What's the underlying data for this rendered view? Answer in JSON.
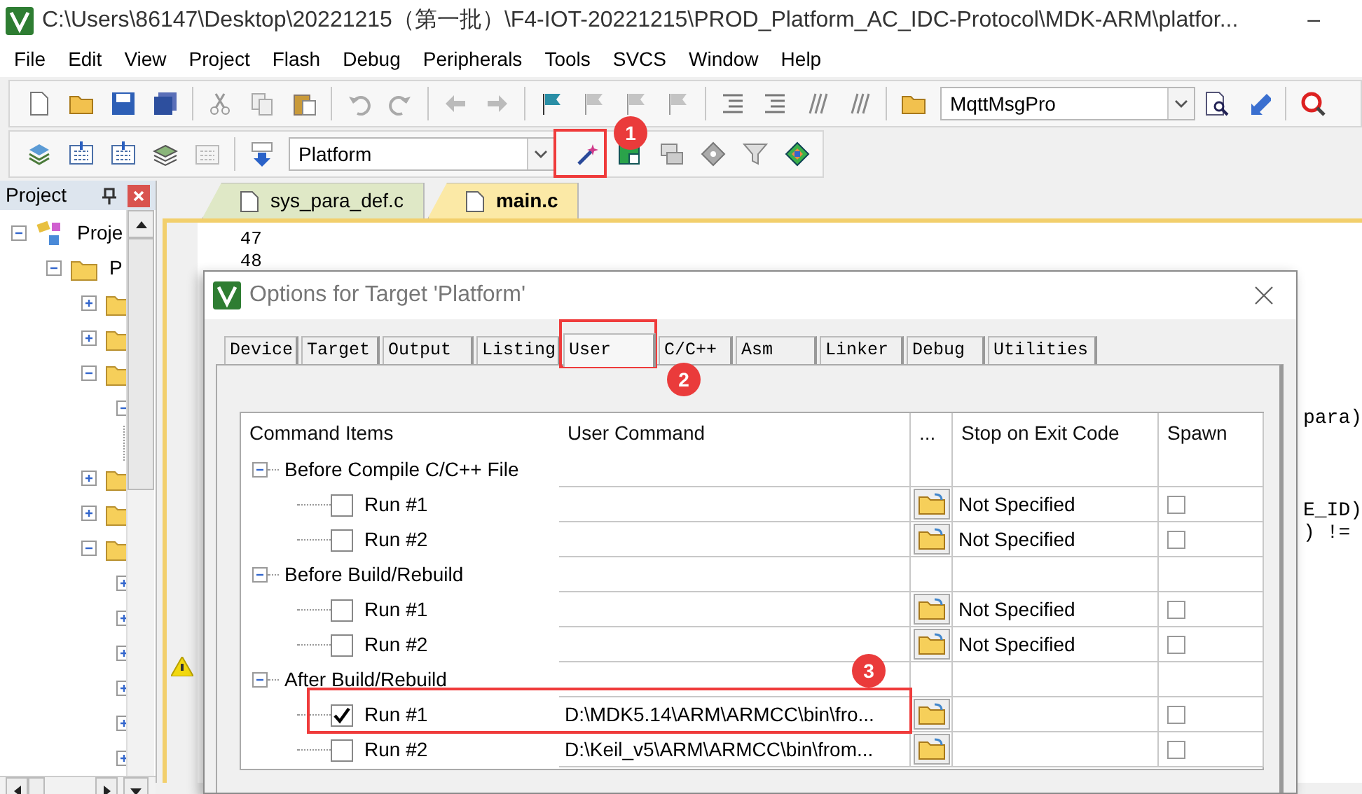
{
  "window": {
    "title": "C:\\Users\\86147\\Desktop\\20221215（第一批）\\F4-IOT-20221215\\PROD_Platform_AC_IDC-Protocol\\MDK-ARM\\platfor...",
    "minimize": "–"
  },
  "menu": [
    {
      "label": "File"
    },
    {
      "label": "Edit"
    },
    {
      "label": "View"
    },
    {
      "label": "Project"
    },
    {
      "label": "Flash"
    },
    {
      "label": "Debug"
    },
    {
      "label": "Peripherals"
    },
    {
      "label": "Tools"
    },
    {
      "label": "SVCS"
    },
    {
      "label": "Window"
    },
    {
      "label": "Help"
    }
  ],
  "toolbar": {
    "file_dropdown": "MqttMsgPro"
  },
  "build_toolbar": {
    "target_dropdown": "Platform"
  },
  "project_panel": {
    "title": "Project",
    "tree": [
      {
        "label": "Proje",
        "expanded": true,
        "children": [
          {
            "label": "P",
            "expanded": true,
            "children": [
              {
                "kind": "folder",
                "expanded": false
              },
              {
                "kind": "folder",
                "expanded": false
              },
              {
                "kind": "folder",
                "expanded": true,
                "children": [
                  {
                    "expanded": true,
                    "children": [
                      {
                        "kind": "file"
                      }
                    ]
                  }
                ]
              },
              {
                "kind": "folder",
                "expanded": false
              },
              {
                "kind": "folder",
                "expanded": false
              },
              {
                "kind": "folder",
                "expanded": true,
                "children": [
                  {
                    "expanded": false
                  },
                  {
                    "expanded": false
                  },
                  {
                    "expanded": false
                  },
                  {
                    "expanded": false
                  },
                  {
                    "expanded": false
                  },
                  {
                    "expanded": false
                  }
                ]
              }
            ]
          }
        ]
      }
    ]
  },
  "editor": {
    "tabs": [
      {
        "label": "sys_para_def.c",
        "selected": false
      },
      {
        "label": "main.c",
        "selected": true
      }
    ],
    "line_numbers": [
      "47",
      "48"
    ],
    "code_fragments": [
      "para)",
      "E_ID)",
      ") !="
    ]
  },
  "dialog": {
    "title": "Options for Target 'Platform'",
    "tabs": [
      {
        "label": "Device",
        "selected": false
      },
      {
        "label": "Target",
        "selected": false
      },
      {
        "label": "Output",
        "selected": false
      },
      {
        "label": "Listing",
        "selected": false
      },
      {
        "label": "User",
        "selected": true
      },
      {
        "label": "C/C++",
        "selected": false
      },
      {
        "label": "Asm",
        "selected": false
      },
      {
        "label": "Linker",
        "selected": false
      },
      {
        "label": "Debug",
        "selected": false
      },
      {
        "label": "Utilities",
        "selected": false
      }
    ],
    "table": {
      "columns": [
        "Command Items",
        "User Command",
        "...",
        "Stop on Exit Code",
        "Spawn"
      ],
      "groups": [
        {
          "label": "Before Compile C/C++ File",
          "expanded": true,
          "children": [
            {
              "label": "Run #1",
              "checked": false,
              "stop_code": "Not Specified",
              "spawn": false
            },
            {
              "label": "Run #2",
              "checked": false,
              "stop_code": "Not Specified",
              "spawn": false
            }
          ]
        },
        {
          "label": "Before Build/Rebuild",
          "expanded": true,
          "children": [
            {
              "label": "Run #1",
              "checked": false,
              "stop_code": "Not Specified",
              "spawn": false
            },
            {
              "label": "Run #2",
              "checked": false,
              "stop_code": "Not Specified",
              "spawn": false
            }
          ]
        },
        {
          "label": "After Build/Rebuild",
          "expanded": true,
          "children": [
            {
              "label": "Run #1",
              "checked": true,
              "command": "D:\\MDK5.14\\ARM\\ARMCC\\bin\\fro...",
              "spawn": false
            },
            {
              "label": "Run #2",
              "checked": false,
              "command": "D:\\Keil_v5\\ARM\\ARMCC\\bin\\from...",
              "spawn": false
            }
          ]
        }
      ]
    }
  },
  "annotations": [
    {
      "number": "1"
    },
    {
      "number": "2"
    },
    {
      "number": "3"
    }
  ]
}
